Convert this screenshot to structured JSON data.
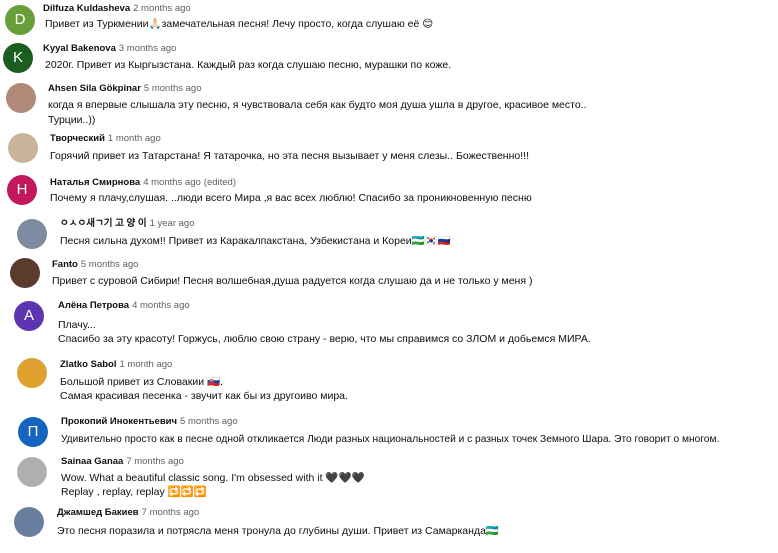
{
  "comments": [
    {
      "author": "Dilfuza Kuldasheva",
      "time": "2 months ago",
      "edited": "",
      "avatar": {
        "letter": "D",
        "color": "#689f38"
      },
      "lines": [
        "Привет из Туркмении🙏🏻замечательная песня! Лечу просто, когда слушаю её 😊"
      ]
    },
    {
      "author": "Kyyal Bakenova",
      "time": "3 months ago",
      "edited": "",
      "avatar": {
        "letter": "K",
        "color": "#1b5e20"
      },
      "lines": [
        "2020г. Привет из Кыргызстана.  Каждый раз когда слушаю песню, мурашки по коже."
      ]
    },
    {
      "author": "Ahsen Sila Gökpinar",
      "time": "5 months ago",
      "edited": "",
      "avatar": {
        "letter": "",
        "color": "#b08a78"
      },
      "lines": [
        "когда я впервые слышала эту песню, я чувствовала себя как будто моя душа ушла в другое, красивое место..",
        "Турции..))"
      ]
    },
    {
      "author": "Творческий",
      "time": "1 month ago",
      "edited": "",
      "avatar": {
        "letter": "",
        "color": "#c9b49a"
      },
      "lines": [
        "Горячий привет из Татарстана! Я татарочка, но эта песня вызывает у меня слезы.. Божественно!!!"
      ]
    },
    {
      "author": "Наталья Смирнова",
      "time": "4 months ago",
      "edited": "(edited)",
      "avatar": {
        "letter": "Н",
        "color": "#c2185b"
      },
      "lines": [
        "Почему я плачу,слушая. ..люди всего Мира ,я вас всех люблю! Спасибо за проникновенную песню"
      ]
    },
    {
      "author": "ㅇㅅㅇ새ㄱ기 고 양 이",
      "time": "1 year ago",
      "edited": "",
      "avatar": {
        "letter": "",
        "color": "#7d8aa0"
      },
      "lines": [
        "Песня сильна духом!! Привет из Каракалпакстана, Узбекистана и Кореи🇺🇿🇰🇷🇷🇺"
      ]
    },
    {
      "author": "Fanto",
      "time": "5 months ago",
      "edited": "",
      "avatar": {
        "letter": "",
        "color": "#5a3b2e"
      },
      "lines": [
        "Привет с суровой Сибири! Песня волшебная,душа радуется когда слушаю да и не только у меня )"
      ]
    },
    {
      "author": "Алёна Петрова",
      "time": "4 months ago",
      "edited": "",
      "avatar": {
        "letter": "А",
        "color": "#5e35b1"
      },
      "lines": [
        "Плачу...",
        "Спасибо за эту красоту! Горжусь, люблю свою страну - верю, что мы справимся со ЗЛОМ и добьемся МИРА."
      ]
    },
    {
      "author": "Zlatko Sabol",
      "time": "1 month ago",
      "edited": "",
      "avatar": {
        "letter": "",
        "color": "#e0a030"
      },
      "lines": [
        "Большой привет из Словакии 🇸🇰.",
        "Самая красивая песенка - звучит как бы из другоиво мира."
      ]
    },
    {
      "author": "Прокопий Инокентьевич",
      "time": "5 months ago",
      "edited": "",
      "avatar": {
        "letter": "П",
        "color": "#1565c0"
      },
      "lines": [
        "Удивительно просто как в песне одной откликается Люди разных национальностей и с разных точек Земного Шара. Это говорит о многом."
      ]
    },
    {
      "author": "Sainaa Ganaa",
      "time": "7 months ago",
      "edited": "",
      "avatar": {
        "letter": "",
        "color": "#b0b0b0"
      },
      "lines": [
        "Wow. What a beautiful classic song. I'm obsessed with it 🖤🖤🖤",
        "Replay , replay, replay 🔁🔁🔁"
      ]
    },
    {
      "author": "Джамшед Бакиев",
      "time": "7 months ago",
      "edited": "",
      "avatar": {
        "letter": "",
        "color": "#6a7fa0"
      },
      "lines": [
        "Это песня поразила и потрясла меня  тронула до глубины души. Привет из Самарканда🇺🇿"
      ]
    }
  ]
}
